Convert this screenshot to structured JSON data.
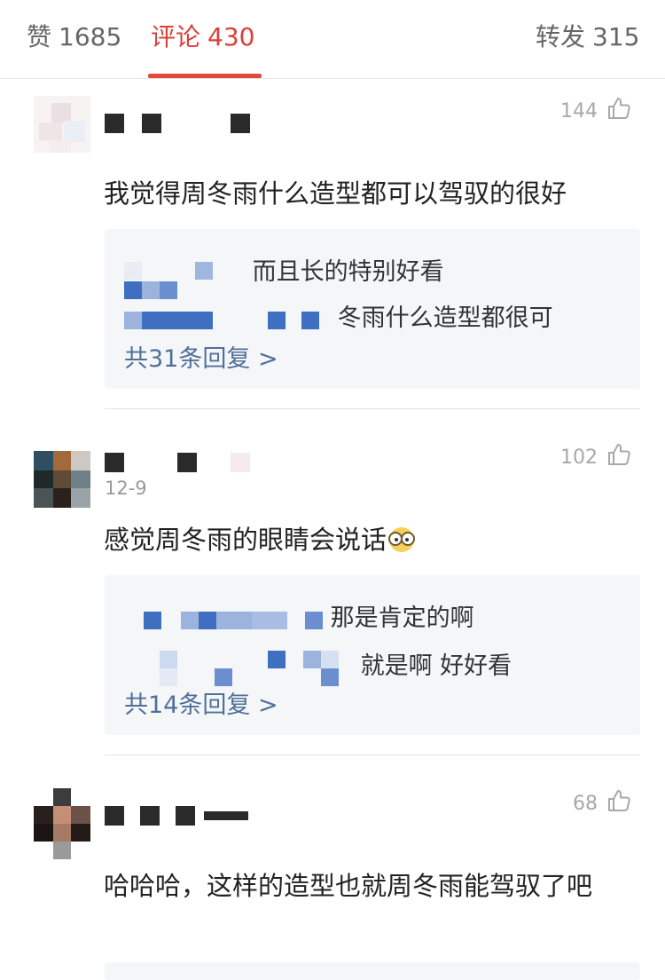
{
  "tabs": {
    "likes": {
      "label": "赞",
      "count": "1685"
    },
    "comments": {
      "label": "评论",
      "count": "430"
    },
    "reposts": {
      "label": "转发",
      "count": "315"
    }
  },
  "comments": [
    {
      "date": "",
      "likes": "144",
      "text": "我觉得周冬雨什么造型都可以驾驭的很好",
      "replies": [
        {
          "text": "而且长的特别好看"
        },
        {
          "text": "冬雨什么造型都很可"
        }
      ],
      "more": "共31条回复 >"
    },
    {
      "date": "12-9",
      "likes": "102",
      "text": "感觉周冬雨的眼睛会说话",
      "replies": [
        {
          "text": "那是肯定的啊"
        },
        {
          "text": "就是啊 好好看"
        }
      ],
      "more": "共14条回复 >"
    },
    {
      "date": "",
      "likes": "68",
      "text": "哈哈哈，这样的造型也就周冬雨能驾驭了吧"
    }
  ],
  "colors": {
    "accent": "#e2483c",
    "reply_link": "#50709a",
    "mosaic_blue": "#3f6fc0"
  },
  "icons": {
    "like": "thumb-up-icon",
    "emoji": "glasses-emoji-icon"
  }
}
